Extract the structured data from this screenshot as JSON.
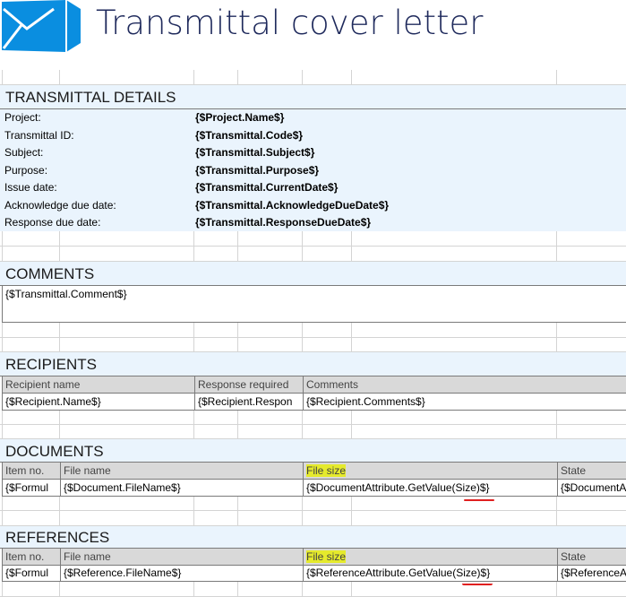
{
  "header": {
    "title": "Transmittal cover letter",
    "logo_icon": "envelope-icon",
    "logo_color": "#0a8ee0"
  },
  "details": {
    "heading": "TRANSMITTAL DETAILS",
    "rows": [
      {
        "label": "Project:",
        "value": "{$Project.Name$}"
      },
      {
        "label": "Transmittal ID:",
        "value": "{$Transmittal.Code$}"
      },
      {
        "label": "Subject:",
        "value": "{$Transmittal.Subject$}"
      },
      {
        "label": "Purpose:",
        "value": "{$Transmittal.Purpose$}"
      },
      {
        "label": "Issue date:",
        "value": "{$Transmittal.CurrentDate$}"
      },
      {
        "label": "Acknowledge due date:",
        "value": "{$Transmittal.AcknowledgeDueDate$}"
      },
      {
        "label": "Response due date:",
        "value": "{$Transmittal.ResponseDueDate$}"
      }
    ]
  },
  "comments": {
    "heading": "COMMENTS",
    "value": "{$Transmittal.Comment$}"
  },
  "recipients": {
    "heading": "RECIPIENTS",
    "columns": [
      "Recipient name",
      "Response required",
      "Comments"
    ],
    "row": [
      "{$Recipient.Name$}",
      "{$Recipient.Respon",
      "{$Recipient.Comments$}"
    ]
  },
  "documents": {
    "heading": "DOCUMENTS",
    "columns": [
      "Item no.",
      "File name",
      "File size",
      "State"
    ],
    "row": [
      "{$Formul",
      "{$Document.FileName$}",
      "{$DocumentAttribute.GetValue(Size)$}",
      "{$DocumentA"
    ]
  },
  "references": {
    "heading": "REFERENCES",
    "columns": [
      "Item no.",
      "File name",
      "File size",
      "State"
    ],
    "row": [
      "{$Formul",
      "{$Reference.FileName$}",
      "{$ReferenceAttribute.GetValue(Size)$}",
      "{$ReferenceA"
    ]
  }
}
